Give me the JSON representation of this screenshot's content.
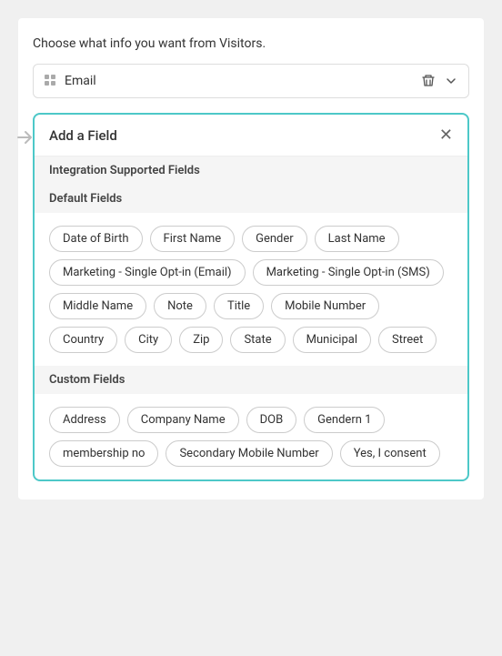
{
  "header": {
    "instruction": "Choose what info you want from Visitors."
  },
  "email_row": {
    "label": "Email",
    "delete_icon": "🗑",
    "chevron_icon": "▾"
  },
  "panel": {
    "title": "Add a Field",
    "close_icon": "✕",
    "arrow": "➔",
    "integration_label": "Integration Supported Fields",
    "default_section_label": "Default Fields",
    "default_fields": [
      "Date of Birth",
      "First Name",
      "Gender",
      "Last Name",
      "Marketing - Single Opt-in (Email)",
      "Marketing - Single Opt-in (SMS)",
      "Middle Name",
      "Note",
      "Title",
      "Mobile Number",
      "Country",
      "City",
      "Zip",
      "State",
      "Municipal",
      "Street"
    ],
    "custom_section_label": "Custom Fields",
    "custom_fields": [
      "Address",
      "Company Name",
      "DOB",
      "Gendern 1",
      "membership no",
      "Secondary Mobile Number",
      "Yes, I consent"
    ]
  }
}
